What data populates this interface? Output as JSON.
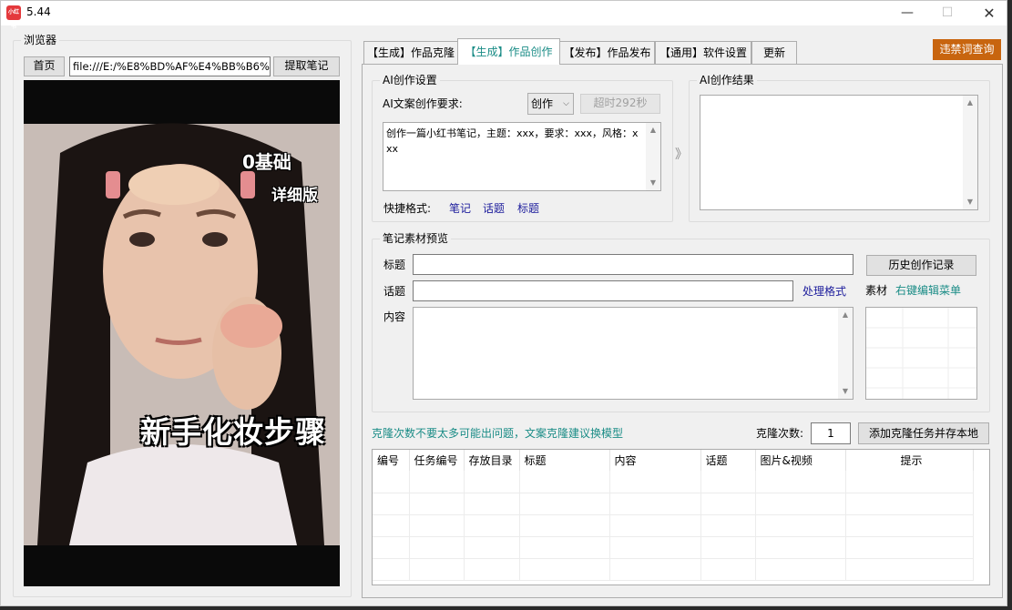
{
  "window": {
    "title": "5.44",
    "app_icon_text": "小红书"
  },
  "browser": {
    "group_title": "浏览器",
    "home_label": "首页",
    "url_value": "file:///E:/%E8%BD%AF%E4%BB%B6%",
    "extract_label": "提取笔记",
    "video_texts": {
      "line1": "0基础",
      "line2": "详细版",
      "caption": "新手化妆步骤"
    }
  },
  "tabs": [
    {
      "label": "【生成】作品克隆"
    },
    {
      "label": "【生成】作品创作"
    },
    {
      "label": "【发布】作品发布"
    },
    {
      "label": "【通用】软件设置"
    },
    {
      "label": "更新"
    }
  ],
  "banned_words_label": "违禁词查询",
  "ai_settings": {
    "group_title": "AI创作设置",
    "requirement_label": "AI文案创作要求:",
    "mode_value": "创作",
    "timeout_label": "超时292秒",
    "prompt_text": "创作一篇小红书笔记，主题：xxx，要求：xxx，风格：xxx",
    "quick_format_label": "快捷格式:",
    "quick_links": [
      "笔记",
      "话题",
      "标题"
    ]
  },
  "arrow_glyph": "》",
  "ai_result": {
    "group_title": "AI创作结果",
    "text": ""
  },
  "preview": {
    "group_title": "笔记素材预览",
    "title_label": "标题",
    "title_value": "",
    "history_label": "历史创作记录",
    "topic_label": "话题",
    "topic_value": "",
    "format_link": "处理格式",
    "material_label": "素材",
    "edit_menu_link": "右键编辑菜单",
    "content_label": "内容",
    "content_value": ""
  },
  "clone": {
    "notice": "克隆次数不要太多可能出问题，文案克隆建议换模型",
    "count_label": "克隆次数:",
    "count_value": "1",
    "add_task_label": "添加克隆任务并存本地"
  },
  "task_table": {
    "columns": [
      "编号",
      "任务编号",
      "存放目录",
      "标题",
      "内容",
      "话题",
      "图片&视频",
      "提示"
    ],
    "rows": []
  },
  "colors": {
    "accent_orange": "#c8650f",
    "link_teal": "#1a8c86",
    "link_blue": "#1c1c9c"
  }
}
